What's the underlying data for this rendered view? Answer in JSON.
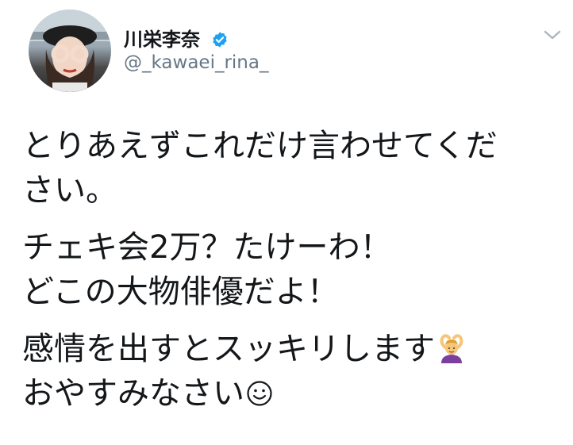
{
  "user": {
    "display_name": "川栄李奈",
    "handle": "@_kawaei_rina_",
    "verified_icon": "verified-badge-icon"
  },
  "menu": {
    "icon": "chevron-down-icon"
  },
  "tweet": {
    "paragraphs": [
      [
        "とりあえずこれだけ言わせてくだ",
        "さい。"
      ],
      [
        "チェキ会2万？たけーわ！",
        "どこの大物俳優だよ！"
      ],
      [
        "感情を出すとスッキリします",
        "おやすみなさい"
      ]
    ],
    "emojis": [
      "person-gesturing-ok-emoji",
      "smiling-face-emoji"
    ]
  },
  "colors": {
    "text": "#14171a",
    "handle": "#657786",
    "verified": "#1da1f2",
    "chevron": "#aab8c2"
  }
}
